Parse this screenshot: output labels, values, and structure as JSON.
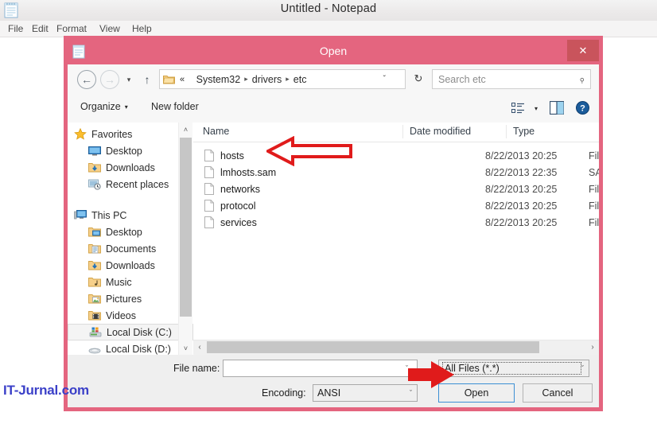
{
  "notepad": {
    "title": "Untitled - Notepad",
    "icon": "notepad-icon",
    "menus": [
      "File",
      "Edit",
      "Format",
      "View",
      "Help"
    ]
  },
  "watermark": "IT-Jurnal.com",
  "dialog": {
    "title": "Open",
    "close_label": "✕",
    "accent_color": "#e4657f",
    "close_color": "#c9545c",
    "address": {
      "back_icon": "←",
      "forward_icon": "→",
      "dropdown_icon": "▾",
      "up_icon": "↑",
      "refresh_icon": "↻",
      "chevron_icon": "ˇ",
      "prefix": "«",
      "crumbs": [
        "System32",
        "drivers",
        "etc"
      ],
      "separator": "▸"
    },
    "search": {
      "placeholder": "Search etc",
      "icon": "⌕"
    },
    "toolbar": {
      "organize_label": "Organize",
      "organize_caret": "▾",
      "new_folder_label": "New folder",
      "view_caret": "▾",
      "view_options_icon": "view-options-icon",
      "preview_pane_icon": "preview-pane-icon",
      "help_icon": "?"
    },
    "nav_pane": {
      "groups": [
        {
          "header": {
            "label": "Favorites",
            "icon": "star-icon"
          },
          "items": [
            {
              "label": "Desktop",
              "icon": "desktop-icon"
            },
            {
              "label": "Downloads",
              "icon": "downloads-icon"
            },
            {
              "label": "Recent places",
              "icon": "recent-places-icon"
            }
          ]
        },
        {
          "header": {
            "label": "This PC",
            "icon": "this-pc-icon"
          },
          "items": [
            {
              "label": "Desktop",
              "icon": "desktop-folder-icon"
            },
            {
              "label": "Documents",
              "icon": "documents-icon"
            },
            {
              "label": "Downloads",
              "icon": "downloads-icon"
            },
            {
              "label": "Music",
              "icon": "music-icon"
            },
            {
              "label": "Pictures",
              "icon": "pictures-icon"
            },
            {
              "label": "Videos",
              "icon": "videos-icon"
            },
            {
              "label": "Local Disk (C:)",
              "icon": "drive-icon",
              "selected": true
            },
            {
              "label": "Local Disk (D:)",
              "icon": "optical-drive-icon"
            }
          ]
        }
      ],
      "scroll_up_icon": "˄",
      "scroll_down_icon": "˅"
    },
    "file_list": {
      "columns": [
        "Name",
        "Date modified",
        "Type"
      ],
      "rows": [
        {
          "name": "hosts",
          "date": "8/22/2013 20:25",
          "type": "File"
        },
        {
          "name": "lmhosts.sam",
          "date": "8/22/2013 22:35",
          "type": "SAM File"
        },
        {
          "name": "networks",
          "date": "8/22/2013 20:25",
          "type": "File"
        },
        {
          "name": "protocol",
          "date": "8/22/2013 20:25",
          "type": "File"
        },
        {
          "name": "services",
          "date": "8/22/2013 20:25",
          "type": "File"
        }
      ],
      "scroll_left_icon": "‹",
      "scroll_right_icon": "›"
    },
    "form": {
      "filename_label": "File name:",
      "filename_value": "",
      "filename_caret": "ˇ",
      "filetype_value": "All Files  (*.*)",
      "filetype_caret": "ˇ",
      "encoding_label": "Encoding:",
      "encoding_value": "ANSI",
      "encoding_caret": "ˇ",
      "open_label": "Open",
      "cancel_label": "Cancel"
    },
    "annotations": [
      {
        "name": "arrow-pointing-at-hosts",
        "color": "#e01b1b",
        "direction": "left",
        "style": "outline"
      },
      {
        "name": "arrow-pointing-at-filetype",
        "color": "#e01b1b",
        "direction": "right",
        "style": "solid"
      }
    ]
  }
}
